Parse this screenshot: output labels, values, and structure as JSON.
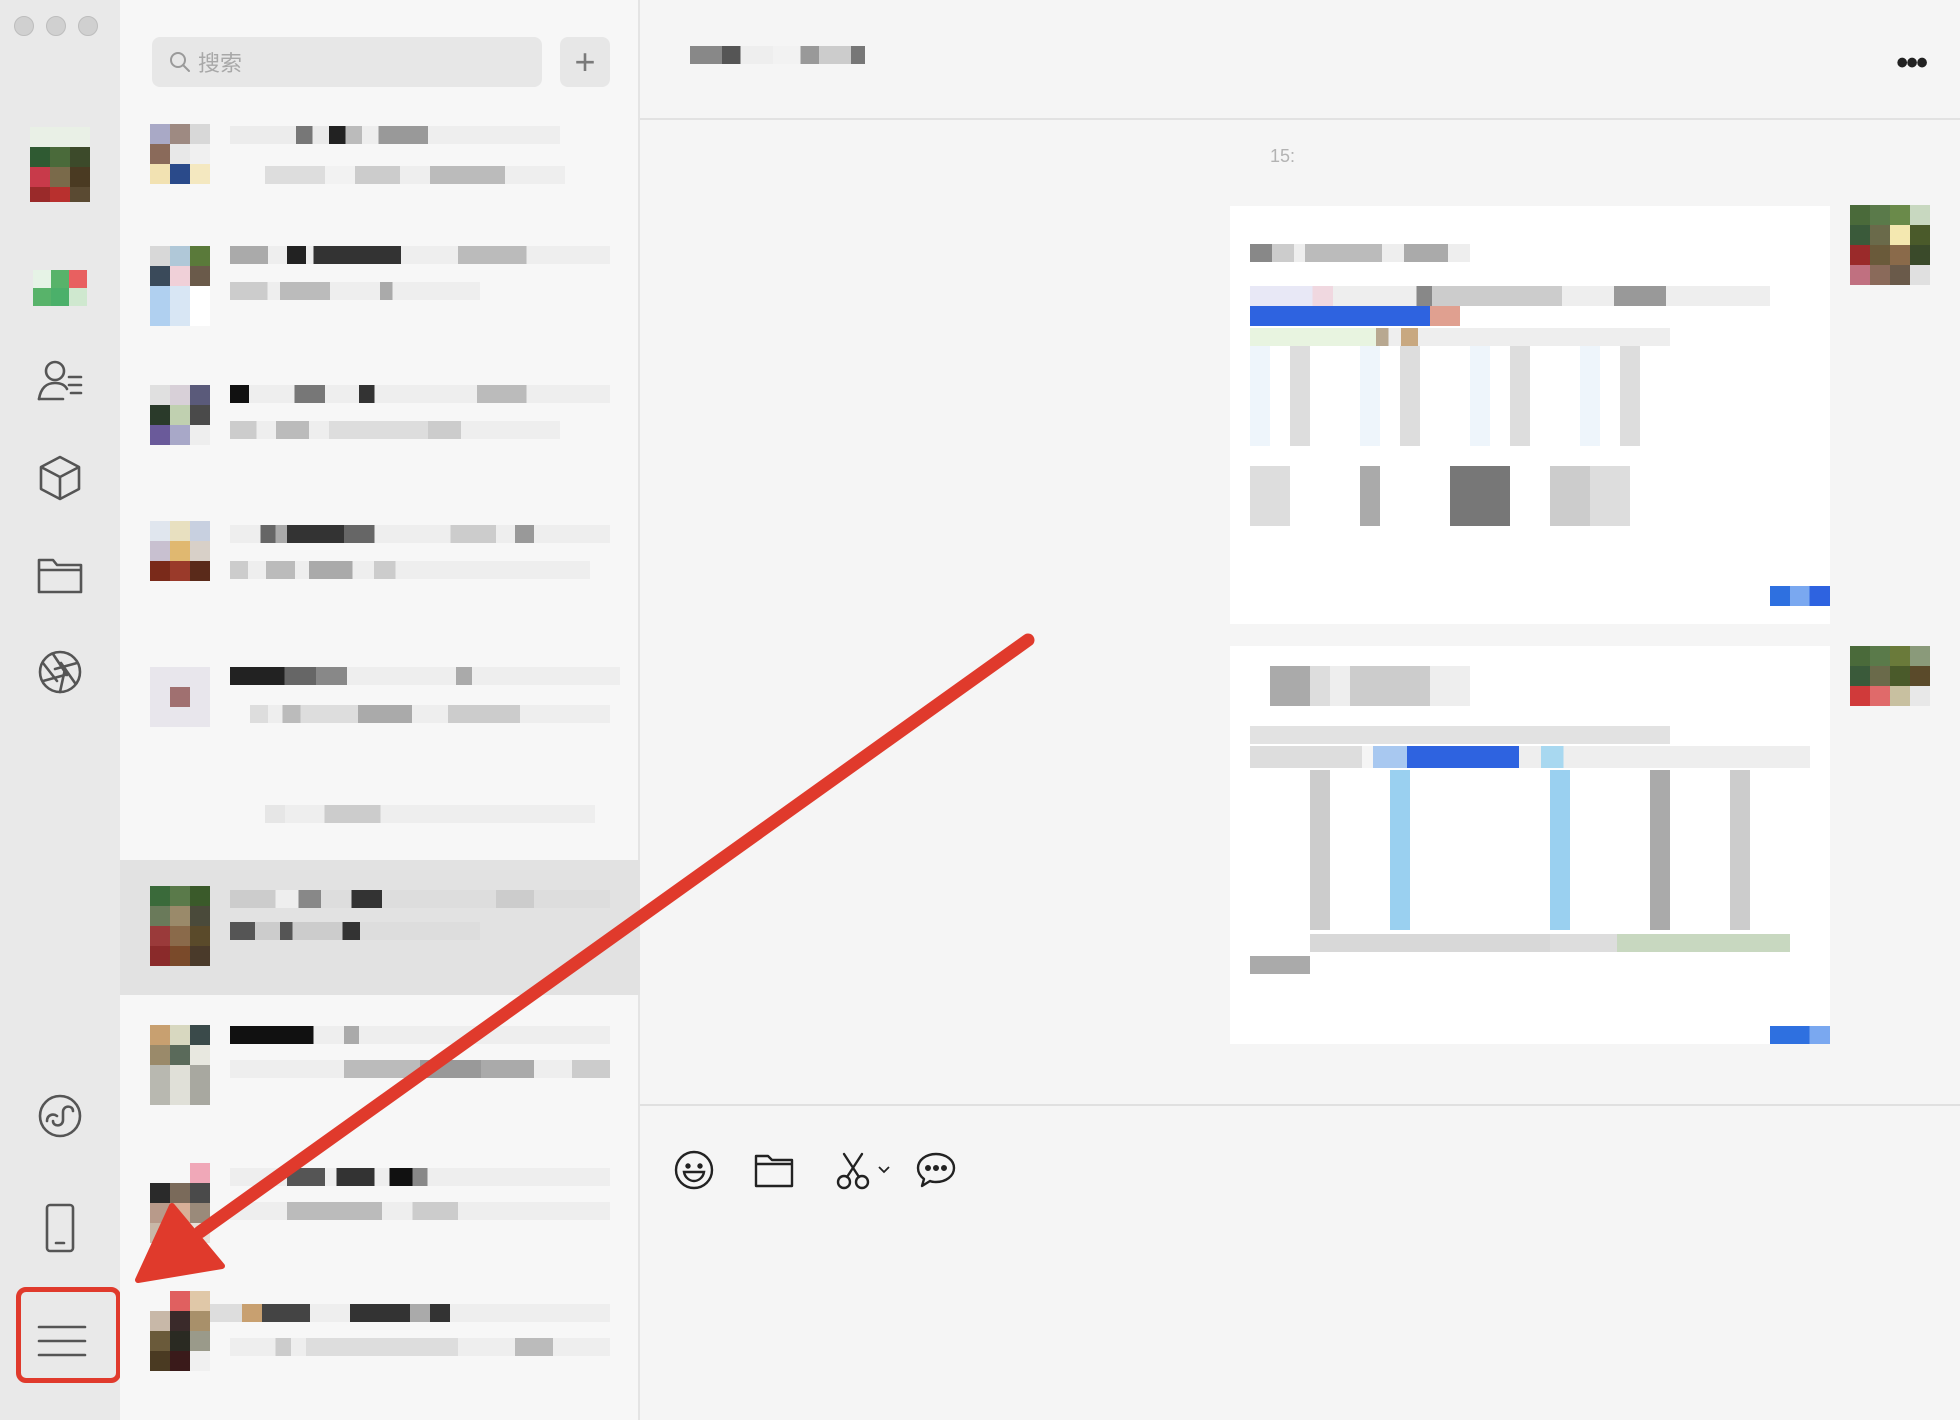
{
  "window": {
    "title": ""
  },
  "search": {
    "placeholder": "搜索"
  },
  "add_button_label": "+",
  "conversation": {
    "title": "",
    "more_label": "•••",
    "timestamp": "15:"
  },
  "rail": {
    "items": [
      {
        "icon": "chats-icon"
      },
      {
        "icon": "contacts-icon"
      },
      {
        "icon": "mini-programs-icon"
      },
      {
        "icon": "files-icon"
      },
      {
        "icon": "moments-icon"
      },
      {
        "icon": "channels-icon"
      },
      {
        "icon": "phone-icon"
      },
      {
        "icon": "menu-icon"
      }
    ]
  },
  "composer": {
    "tools": [
      {
        "icon": "emoji-icon"
      },
      {
        "icon": "folder-icon"
      },
      {
        "icon": "scissors-icon"
      },
      {
        "icon": "chat-history-icon"
      }
    ]
  },
  "annotation": {
    "color": "#e03a2c",
    "target": "menu-icon"
  },
  "colors": {
    "accent_annotation": "#e03a2c",
    "selected_row": "#e2e2e2"
  }
}
